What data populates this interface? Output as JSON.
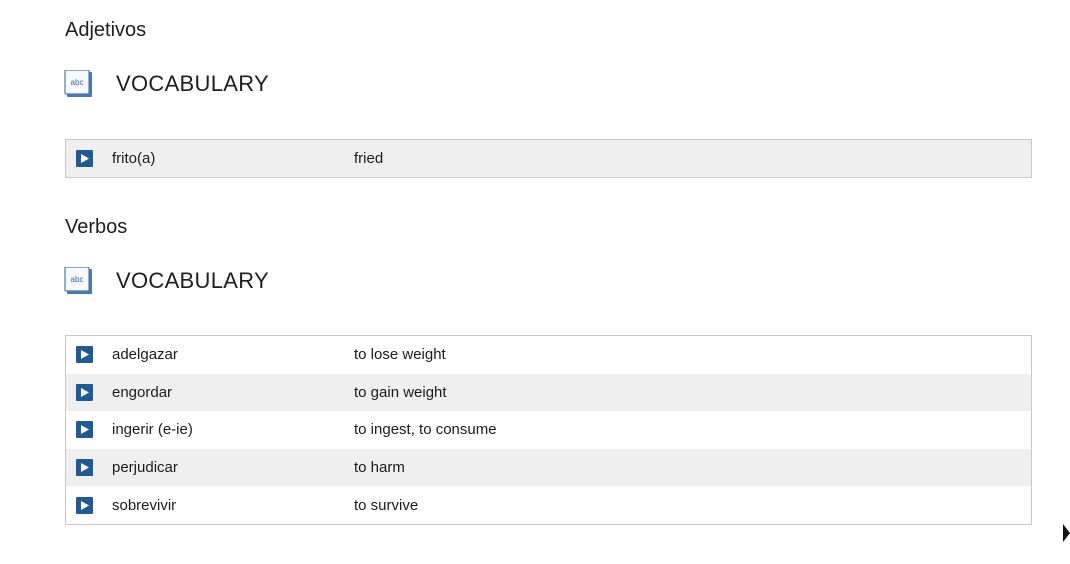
{
  "sections": [
    {
      "heading": "Adjetivos",
      "vocab_title": "VOCABULARY",
      "icon": "abc-book-icon",
      "items": [
        {
          "term": "frito(a)",
          "meaning": "fried"
        }
      ]
    },
    {
      "heading": "Verbos",
      "vocab_title": "VOCABULARY",
      "icon": "abc-book-icon",
      "items": [
        {
          "term": "adelgazar",
          "meaning": "to lose weight"
        },
        {
          "term": "engordar",
          "meaning": "to gain weight"
        },
        {
          "term": "ingerir (e-ie)",
          "meaning": "to ingest, to consume"
        },
        {
          "term": "perjudicar",
          "meaning": "to harm"
        },
        {
          "term": "sobrevivir",
          "meaning": "to survive"
        }
      ]
    }
  ],
  "icon_text": "abc",
  "colors": {
    "play_button": "#1f5a96",
    "row_alt": "#efefef",
    "border": "#c9c9c9"
  }
}
